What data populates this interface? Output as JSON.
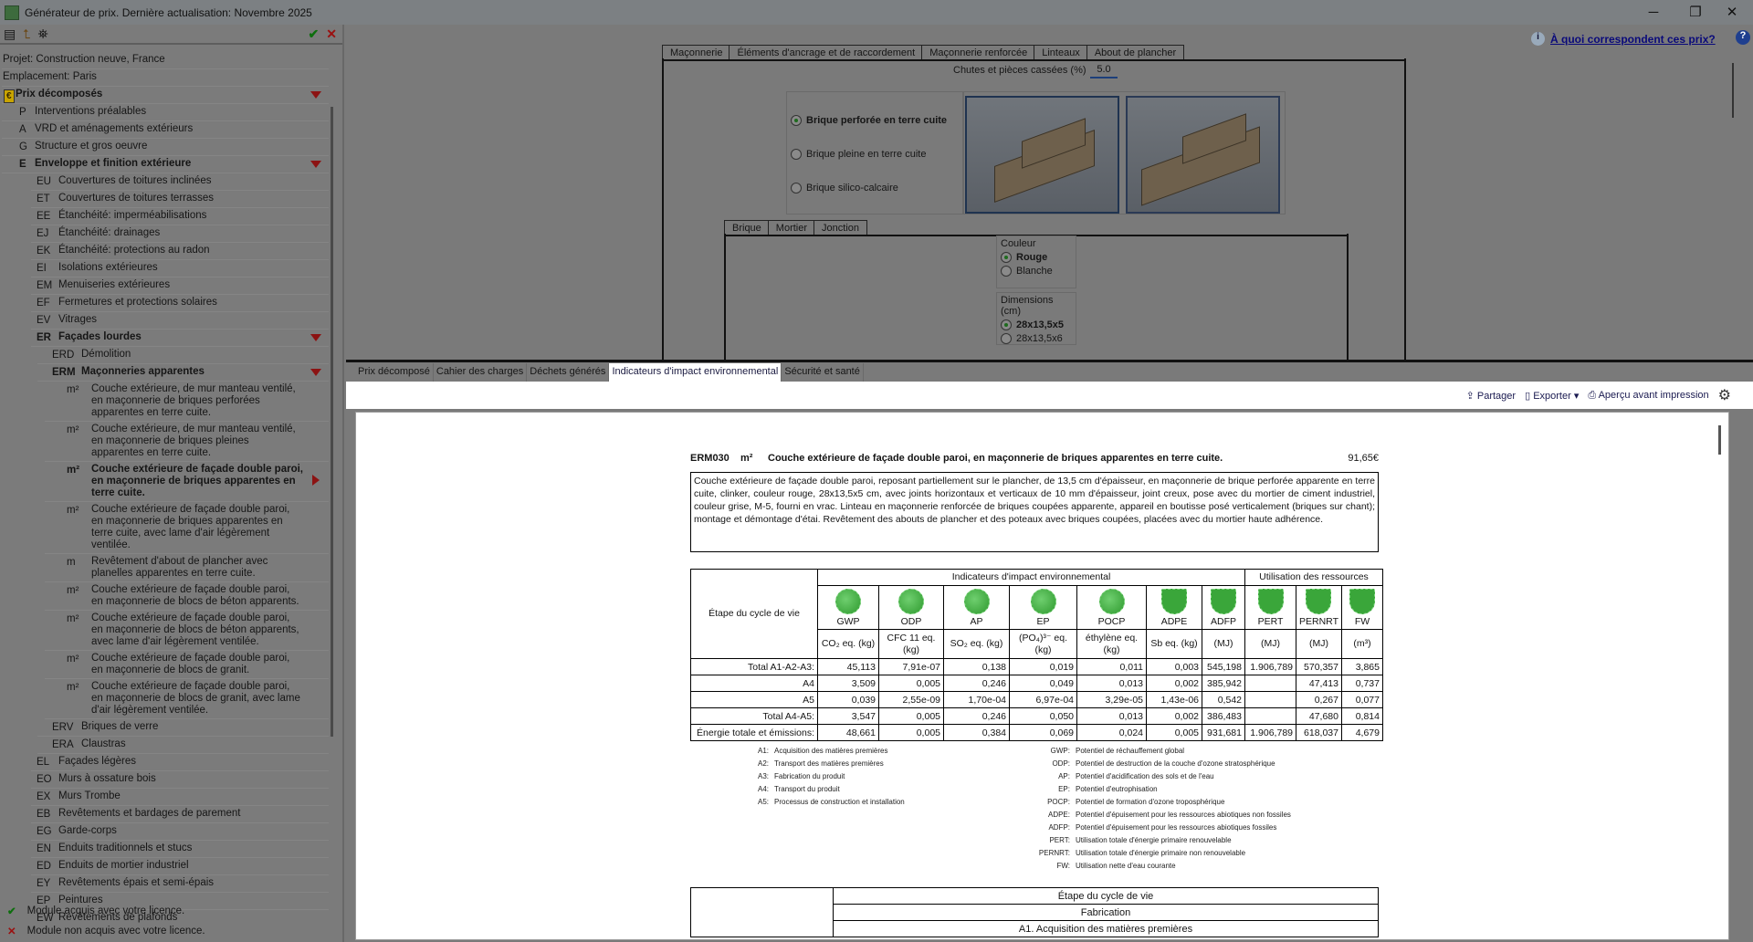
{
  "window": {
    "title": "Générateur de prix. Dernière actualisation: Novembre 2025",
    "minimize": "─",
    "restore": "❐",
    "close": "✕"
  },
  "left": {
    "toolbar": {
      "list_icon": "▤",
      "up_icon": "⮤",
      "binoculars_icon": "⛯",
      "check": "✔",
      "cross": "✕"
    },
    "tree": [
      {
        "code": "",
        "label": "Projet: Construction neuve, France",
        "level": 0
      },
      {
        "code": "",
        "label": "Emplacement: Paris",
        "level": 0
      },
      {
        "code": "€",
        "label": "Prix décomposés",
        "level": 0,
        "bold": true,
        "arrow": "down"
      },
      {
        "code": "P",
        "label": "Interventions préalables",
        "level": 1
      },
      {
        "code": "A",
        "label": "VRD et aménagements extérieurs",
        "level": 1
      },
      {
        "code": "G",
        "label": "Structure et gros oeuvre",
        "level": 1
      },
      {
        "code": "E",
        "label": "Enveloppe et finition extérieure",
        "level": 1,
        "bold": true,
        "arrow": "down"
      },
      {
        "code": "EU",
        "label": "Couvertures de toitures inclinées",
        "level": 2
      },
      {
        "code": "ET",
        "label": "Couvertures de toitures terrasses",
        "level": 2
      },
      {
        "code": "EE",
        "label": "Étanchéité: imperméabilisations",
        "level": 2
      },
      {
        "code": "EJ",
        "label": "Étanchéité: drainages",
        "level": 2
      },
      {
        "code": "EK",
        "label": "Étanchéité: protections au radon",
        "level": 2
      },
      {
        "code": "EI",
        "label": "Isolations extérieures",
        "level": 2
      },
      {
        "code": "EM",
        "label": "Menuiseries extérieures",
        "level": 2
      },
      {
        "code": "EF",
        "label": "Fermetures et protections solaires",
        "level": 2
      },
      {
        "code": "EV",
        "label": "Vitrages",
        "level": 2
      },
      {
        "code": "ER",
        "label": "Façades lourdes",
        "level": 2,
        "bold": true,
        "arrow": "down"
      },
      {
        "code": "ERD",
        "label": "Démolition",
        "level": 3
      },
      {
        "code": "ERM",
        "label": "Maçonneries apparentes",
        "level": 3,
        "bold": true,
        "arrow": "down"
      },
      {
        "code": "m²",
        "label": "Couche extérieure, de mur manteau ventilé, en maçonnerie de briques perforées apparentes en terre cuite.",
        "level": 4
      },
      {
        "code": "m²",
        "label": "Couche extérieure, de mur manteau ventilé, en maçonnerie de briques pleines apparentes en terre cuite.",
        "level": 4
      },
      {
        "code": "m²",
        "label": "Couche extérieure de façade double paroi, en maçonnerie de briques apparentes en terre cuite.",
        "level": 4,
        "bold": true,
        "arrow": "right"
      },
      {
        "code": "m²",
        "label": "Couche extérieure de façade double paroi, en maçonnerie de briques apparentes en terre cuite, avec lame d'air légèrement ventilée.",
        "level": 4
      },
      {
        "code": "m",
        "label": "Revêtement d'about de plancher avec planelles apparentes en terre cuite.",
        "level": 4
      },
      {
        "code": "m²",
        "label": "Couche extérieure de façade double paroi, en maçonnerie de blocs de béton apparents.",
        "level": 4
      },
      {
        "code": "m²",
        "label": "Couche extérieure de façade double paroi, en maçonnerie de blocs de béton apparents, avec lame d'air légèrement ventilée.",
        "level": 4
      },
      {
        "code": "m²",
        "label": "Couche extérieure de façade double paroi, en maçonnerie de blocs de granit.",
        "level": 4
      },
      {
        "code": "m²",
        "label": "Couche extérieure de façade double paroi, en maçonnerie de blocs de granit, avec lame d'air légèrement ventilée.",
        "level": 4
      },
      {
        "code": "ERV",
        "label": "Briques de verre",
        "level": 3
      },
      {
        "code": "ERA",
        "label": "Claustras",
        "level": 3
      },
      {
        "code": "EL",
        "label": "Façades légères",
        "level": 2
      },
      {
        "code": "EO",
        "label": "Murs à ossature bois",
        "level": 2
      },
      {
        "code": "EX",
        "label": "Murs Trombe",
        "level": 2
      },
      {
        "code": "EB",
        "label": "Revêtements et bardages de parement",
        "level": 2
      },
      {
        "code": "EG",
        "label": "Garde-corps",
        "level": 2
      },
      {
        "code": "EN",
        "label": "Enduits traditionnels et stucs",
        "level": 2
      },
      {
        "code": "ED",
        "label": "Enduits de mortier industriel",
        "level": 2
      },
      {
        "code": "EY",
        "label": "Revêtements épais et semi-épais",
        "level": 2
      },
      {
        "code": "EP",
        "label": "Peintures",
        "level": 2
      },
      {
        "code": "EW",
        "label": "Revêtements de plafonds",
        "level": 2
      }
    ],
    "legend": {
      "acquired": "Module acquis avec votre licence.",
      "not_acquired": "Module non acquis avec votre licence."
    }
  },
  "help": {
    "info_icon": "i",
    "link": "À quoi correspondent ces prix?",
    "help_icon": "?"
  },
  "config": {
    "tabs": [
      "Maçonnerie",
      "Éléments d'ancrage et de raccordement",
      "Maçonnerie renforcée",
      "Linteaux",
      "About de plancher"
    ],
    "waste_label": "Chutes et pièces cassées (%)",
    "waste_value": "5.0",
    "brick_options": [
      {
        "label": "Brique perforée en terre cuite",
        "selected": true
      },
      {
        "label": "Brique pleine en terre cuite",
        "selected": false
      },
      {
        "label": "Brique silico-calcaire",
        "selected": false
      }
    ],
    "subtabs": [
      "Brique",
      "Mortier",
      "Jonction"
    ],
    "color_group": {
      "title": "Couleur",
      "options": [
        {
          "label": "Rouge",
          "selected": true
        },
        {
          "label": "Blanche",
          "selected": false
        }
      ]
    },
    "dim_group": {
      "title": "Dimensions (cm)",
      "options": [
        {
          "label": "28x13,5x5",
          "selected": true
        },
        {
          "label": "28x13,5x6",
          "selected": false
        }
      ]
    }
  },
  "bottom_tabs": [
    "Prix décomposé",
    "Cahier des charges",
    "Déchets générés",
    "Indicateurs d'impact environnemental",
    "Sécurité et santé"
  ],
  "toolbar": {
    "share": "Partager",
    "export": "Exporter",
    "preview": "Aperçu avant impression"
  },
  "doc": {
    "code": "ERM030",
    "unit": "m²",
    "title": "Couche extérieure de façade double paroi, en maçonnerie de briques apparentes en terre cuite.",
    "price": "91,65€",
    "description": "Couche extérieure de façade double paroi, reposant partiellement sur le plancher, de 13,5 cm d'épaisseur, en maçonnerie de brique perforée apparente en terre cuite, clinker, couleur rouge, 28x13,5x5 cm, avec joints horizontaux et verticaux de 10 mm d'épaisseur, joint creux, pose avec du mortier de ciment industriel, couleur grise, M-5, fourni en vrac. Linteau en maçonnerie renforcée de briques coupées apparente, appareil en boutisse posé verticalement (briques sur chant); montage et démontage d'étai. Revêtement des abouts de plancher et des poteaux avec briques coupées, placées avec du mortier haute adhérence.",
    "table": {
      "stage_header": "Étape du cycle de vie",
      "group1": "Indicateurs d'impact environnemental",
      "group2": "Utilisation des ressources",
      "indicators": [
        "GWP",
        "ODP",
        "AP",
        "EP",
        "POCP",
        "ADPE",
        "ADFP",
        "PERT",
        "PERNRT",
        "FW"
      ],
      "units": [
        "CO₂ eq. (kg)",
        "CFC 11 eq. (kg)",
        "SO₂ eq. (kg)",
        "(PO₄)³⁻ eq. (kg)",
        "éthylène eq. (kg)",
        "Sb eq. (kg)",
        "(MJ)",
        "(MJ)",
        "(MJ)",
        "(m³)"
      ],
      "rows": [
        {
          "label": "Total A1-A2-A3:",
          "values": [
            "45,113",
            "7,91e-07",
            "0,138",
            "0,019",
            "0,011",
            "0,003",
            "545,198",
            "1.906,789",
            "570,357",
            "3,865"
          ]
        },
        {
          "label": "A4",
          "values": [
            "3,509",
            "0,005",
            "0,246",
            "0,049",
            "0,013",
            "0,002",
            "385,942",
            "",
            "47,413",
            "0,737"
          ]
        },
        {
          "label": "A5",
          "values": [
            "0,039",
            "2,55e-09",
            "1,70e-04",
            "6,97e-04",
            "3,29e-05",
            "1,43e-06",
            "0,542",
            "",
            "0,267",
            "0,077"
          ]
        },
        {
          "label": "Total A4-A5:",
          "values": [
            "3,547",
            "0,005",
            "0,246",
            "0,050",
            "0,013",
            "0,002",
            "386,483",
            "",
            "47,680",
            "0,814"
          ]
        },
        {
          "label": "Énergie totale et émissions:",
          "values": [
            "48,661",
            "0,005",
            "0,384",
            "0,069",
            "0,024",
            "0,005",
            "931,681",
            "1.906,789",
            "618,037",
            "4,679"
          ]
        }
      ],
      "accent": "#3aa63a"
    },
    "legend_stages": [
      [
        "A1:",
        "Acquisition des matières premières"
      ],
      [
        "A2:",
        "Transport des matières premières"
      ],
      [
        "A3:",
        "Fabrication du produit"
      ],
      [
        "A4:",
        "Transport du produit"
      ],
      [
        "A5:",
        "Processus de construction et installation"
      ]
    ],
    "legend_indicators": [
      [
        "GWP:",
        "Potentiel de réchauffement global"
      ],
      [
        "ODP:",
        "Potentiel de destruction de la couche d'ozone stratosphérique"
      ],
      [
        "AP:",
        "Potentiel d'acidification des sols et de l'eau"
      ],
      [
        "EP:",
        "Potentiel d'eutrophisation"
      ],
      [
        "POCP:",
        "Potentiel de formation d'ozone troposphérique"
      ],
      [
        "ADPE:",
        "Potentiel d'épuisement pour les ressources abiotiques non fossiles"
      ],
      [
        "ADFP:",
        "Potentiel d'épuisement pour les ressources abiotiques fossiles"
      ],
      [
        "PERT:",
        "Utilisation totale d'énergie primaire renouvelable"
      ],
      [
        "PERNRT:",
        "Utilisation totale d'énergie primaire non renouvelable"
      ],
      [
        "FW:",
        "Utilisation nette d'eau courante"
      ]
    ],
    "table2": [
      "Étape du cycle de vie",
      "Fabrication",
      "A1. Acquisition des matières premières"
    ]
  }
}
